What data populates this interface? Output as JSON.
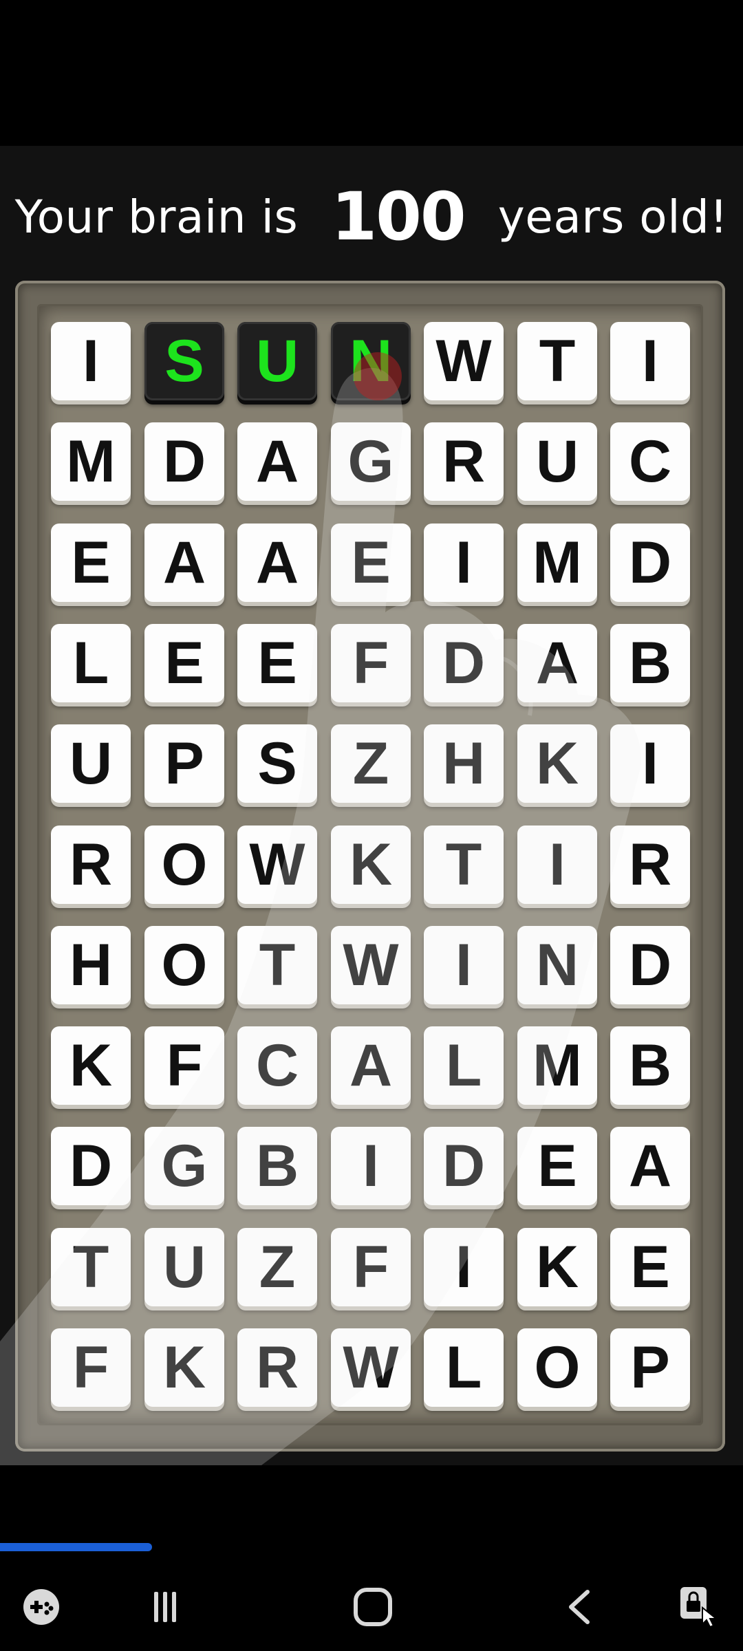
{
  "headline": {
    "prefix": "Your brain is",
    "age": "100",
    "suffix": "years old!"
  },
  "grid": {
    "rows": [
      [
        "I",
        "S",
        "U",
        "N",
        "W",
        "T",
        "I"
      ],
      [
        "M",
        "D",
        "A",
        "G",
        "R",
        "U",
        "C"
      ],
      [
        "E",
        "A",
        "A",
        "E",
        "I",
        "M",
        "D"
      ],
      [
        "L",
        "E",
        "E",
        "F",
        "D",
        "A",
        "B"
      ],
      [
        "U",
        "P",
        "S",
        "Z",
        "H",
        "K",
        "I"
      ],
      [
        "R",
        "O",
        "W",
        "K",
        "T",
        "I",
        "R"
      ],
      [
        "H",
        "O",
        "T",
        "W",
        "I",
        "N",
        "D"
      ],
      [
        "K",
        "F",
        "C",
        "A",
        "L",
        "M",
        "B"
      ],
      [
        "D",
        "G",
        "B",
        "I",
        "D",
        "E",
        "A"
      ],
      [
        "T",
        "U",
        "Z",
        "F",
        "I",
        "K",
        "E"
      ],
      [
        "F",
        "K",
        "R",
        "W",
        "L",
        "O",
        "P"
      ]
    ],
    "selected": [
      [
        0,
        1
      ],
      [
        0,
        2
      ],
      [
        0,
        3
      ]
    ],
    "selected_color": "#1de31d"
  },
  "progress": {
    "fraction": 0.205,
    "color": "#1b5fd6"
  },
  "nav": {
    "buttons": [
      "game-launcher-icon",
      "recent-apps-icon",
      "home-icon",
      "back-icon",
      "screen-lock-icon"
    ]
  }
}
